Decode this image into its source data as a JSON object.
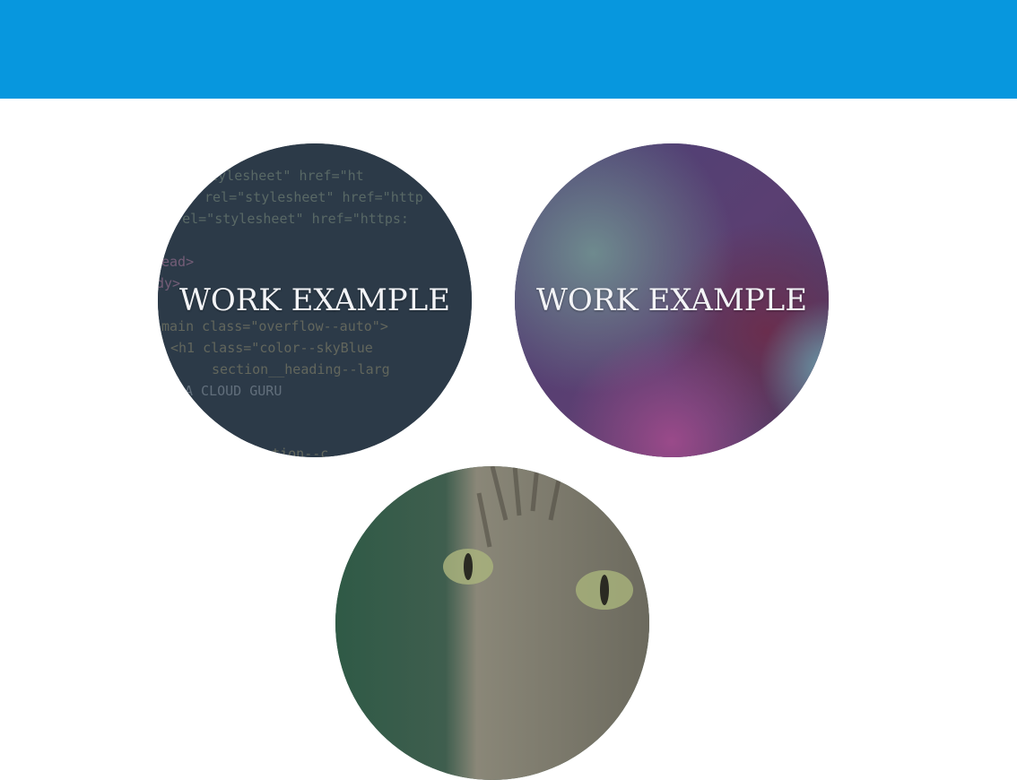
{
  "header": {
    "color": "#0797de"
  },
  "cards": [
    {
      "label": "WORK EXAMPLE",
      "image": "code-editor-screenshot",
      "code_lines": [
        "l=\"stylesheet\" href=\"ht",
        "rel=\"stylesheet\" href=\"http",
        "k rel=\"stylesheet\" href=\"https:",
        "",
        "ead>",
        "dy>",
        "",
        "main class=\"overflow--auto\">",
        " <h1 class=\"color--skyBlue",
        "      section__heading--larg",
        "A CLOUD GURU",
        ">",
        "",
        "      section--c"
      ]
    },
    {
      "label": "WORK EXAMPLE",
      "image": "abstract-purple-gradient"
    },
    {
      "label": "",
      "image": "cat-photo"
    }
  ]
}
